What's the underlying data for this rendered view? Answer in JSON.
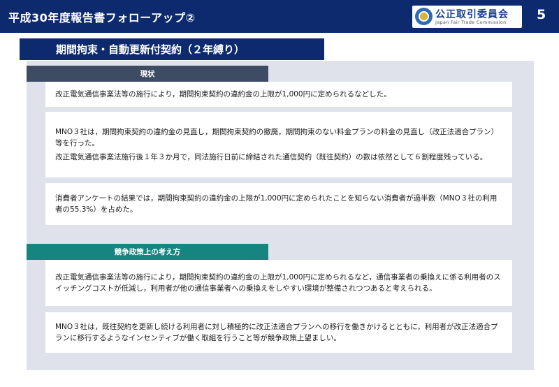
{
  "header": {
    "title": "平成30年度報告書フォローアップ②",
    "logo_jp": "公正取引委員会",
    "logo_en": "Japan Fair Trade Commission",
    "page_number": "5"
  },
  "subtitle": "期間拘束・自動更新付契約（２年縛り）",
  "sections": {
    "current": {
      "label": "現状",
      "cards": [
        [
          "改正電気通信事業法等の施行により，期間拘束契約の違約金の上限が1,000円に定められるなどした。"
        ],
        [
          "MNO３社は，期間拘束契約の違約金の見直し，期間拘束契約の撤廃，期間拘束のない料金プランの料金の見直し（改正法適合プラン）等を行った。",
          "改正電気通信事業法施行後１年３か月で，同法施行日前に締結された通信契約（既往契約）の数は依然として６割程度残っている。"
        ],
        [
          "消費者アンケートの結果では，期間拘束契約の違約金の上限が1,000円に定められたことを知らない消費者が過半数（MNO３社の利用者の55.3%）を占めた。"
        ]
      ]
    },
    "policy": {
      "label": "競争政策上の考え方",
      "cards": [
        [
          "改正電気通信事業法等の施行により，期間拘束契約の違約金の上限が1,000円に定められるなど，通信事業者の乗換えに係る利用者のスイッチングコストが低減し，利用者が他の通信事業者への乗換えをしやすい環境が整備されつつあると考えられる。"
        ],
        [
          "MNO３社は，既往契約を更新し続ける利用者に対し積極的に改正法適合プランへの移行を働きかけるとともに，利用者が改正法適合プランに移行するようなインセンティブが働く取組を行うこと等が競争政策上望ましい。"
        ]
      ]
    }
  }
}
